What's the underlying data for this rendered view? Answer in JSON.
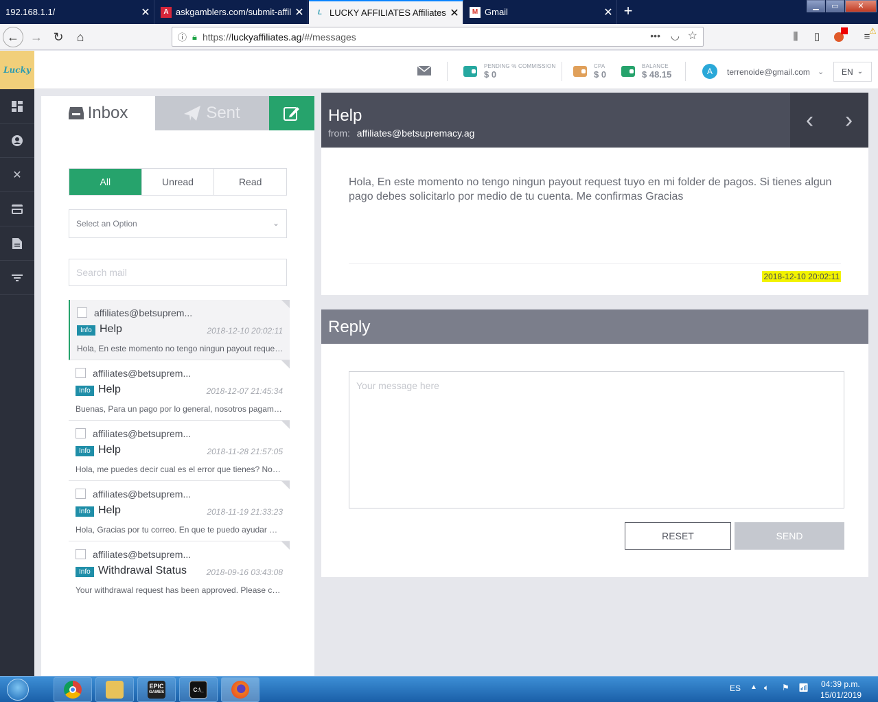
{
  "browser": {
    "tabs": [
      {
        "title": "192.168.1.1/",
        "favicon": "none",
        "active": false
      },
      {
        "title": "askgamblers.com/submit-affili",
        "favicon": "askgamblers-icon",
        "active": false
      },
      {
        "title": "LUCKY AFFILIATES Affiliates",
        "favicon": "lucky-icon",
        "active": true
      },
      {
        "title": "Gmail",
        "favicon": "gmail-icon",
        "active": false
      }
    ],
    "url_prefix": "https://",
    "url_host": "luckyaffiliates.ag",
    "url_path": "/#/messages",
    "window_controls": {
      "minimize": "▁",
      "maximize": "▭",
      "close": "✕"
    }
  },
  "header": {
    "logo_text": "Lucky",
    "stats": [
      {
        "label": "PENDING % COMMISSION",
        "value": "$ 0",
        "color": "#26a8a0"
      },
      {
        "label": "CPA",
        "value": "$ 0",
        "color": "#e0a05a"
      },
      {
        "label": "BALANCE",
        "value": "$ 48.15",
        "color": "#26a36c"
      }
    ],
    "avatar_letter": "A",
    "user_email": "terrenoide@gmail.com",
    "language": "EN"
  },
  "sidebar": {
    "items": [
      {
        "icon": "dashboard-icon"
      },
      {
        "icon": "user-icon"
      },
      {
        "icon": "tools-icon"
      },
      {
        "icon": "card-icon"
      },
      {
        "icon": "document-icon"
      },
      {
        "icon": "filter-icon"
      }
    ]
  },
  "mail": {
    "inbox_label": "Inbox",
    "sent_label": "Sent",
    "filters": {
      "all": "All",
      "unread": "Unread",
      "read": "Read"
    },
    "select_placeholder": "Select an Option",
    "search_placeholder": "Search mail",
    "messages": [
      {
        "from": "affiliates@betsuprem...",
        "badge": "Info",
        "subject": "Help",
        "date": "2018-12-10 20:02:11",
        "preview": "Hola, En este momento no tengo ningun payout reques..."
      },
      {
        "from": "affiliates@betsuprem...",
        "badge": "Info",
        "subject": "Help",
        "date": "2018-12-07 21:45:34",
        "preview": "Buenas, Para un pago por lo general, nosotros pagamos..."
      },
      {
        "from": "affiliates@betsuprem...",
        "badge": "Info",
        "subject": "Help",
        "date": "2018-11-28 21:57:05",
        "preview": "Hola, me puedes decir cual es el error que tienes? No te ..."
      },
      {
        "from": "affiliates@betsuprem...",
        "badge": "Info",
        "subject": "Help",
        "date": "2018-11-19 21:33:23",
        "preview": "Hola, Gracias por tu correo. En que te puedo ayudar Mark"
      },
      {
        "from": "affiliates@betsuprem...",
        "badge": "Info",
        "subject": "Withdrawal Status",
        "date": "2018-09-16 03:43:08",
        "preview": "Your withdrawal request has been approved. Please che..."
      }
    ]
  },
  "view": {
    "subject": "Help",
    "from_label": "from:",
    "from_address": "affiliates@betsupremacy.ag",
    "body": "Hola, En este momento no tengo ningun payout request tuyo en mi folder de pagos. Si tienes algun pago debes solicitarlo por medio de tu cuenta. Me confirmas Gracias",
    "date": "2018-12-10 20:02:11"
  },
  "reply": {
    "title": "Reply",
    "placeholder": "Your message here",
    "reset_label": "RESET",
    "send_label": "SEND"
  },
  "taskbar": {
    "language": "ES",
    "time": "04:39 p.m.",
    "date": "15/01/2019",
    "epic_label": "EPIC",
    "epic_sub": "GAMES"
  }
}
